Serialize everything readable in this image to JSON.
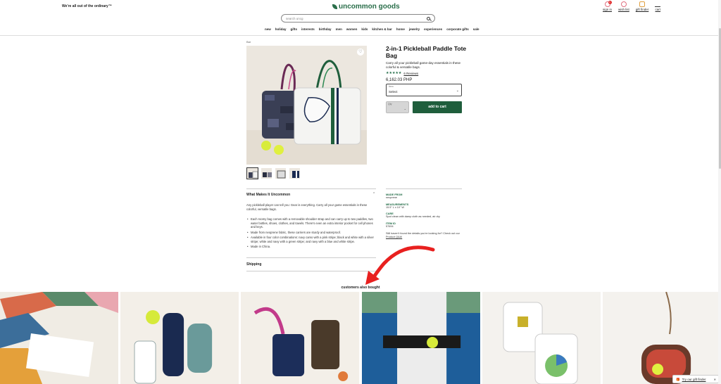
{
  "header": {
    "tagline": "We're all out of the ordinary™",
    "logo": "uncommon goods",
    "search_placeholder": "search uncg",
    "icons": [
      {
        "label": "sign in",
        "icon": "user-icon",
        "badge": "1"
      },
      {
        "label": "wish list",
        "icon": "heart-icon"
      },
      {
        "label": "gift finder",
        "icon": "gift-icon"
      },
      {
        "label": "cart",
        "icon": "cart-icon"
      }
    ],
    "nav": [
      "new",
      "holiday",
      "gifts",
      "interests",
      "birthday",
      "men",
      "women",
      "kids",
      "kitchen & bar",
      "home",
      "jewelry",
      "experiences",
      "corporate gifts",
      "sale"
    ]
  },
  "product": {
    "breadcrumb": "Bar",
    "title": "2-in-1 Pickleball Paddle Tote Bag",
    "description": "Carry all your pickleball game-day essentials in these colorful & versatile bags.",
    "stars": "★★★★★",
    "reviews": "6 Reviews",
    "price": "6,162.03 PHP",
    "select_label": "Item",
    "select_value": "Select",
    "qty_label": "Qty",
    "add_to_cart": "add to cart",
    "rating_color": "#1f6b45",
    "button_color": "#1f5e3c"
  },
  "details": {
    "section_title": "What Makes It Uncommon",
    "intro": "Any pickleball player can tell you: Gear is everything. Carry all your game essentials in these colorful, versatile bags.",
    "bullets": [
      "Each roomy bag comes with a removable shoulder strap and can carry up to two paddles, two water bottles, shoes, clothes, and towels. There's even an extra interior pocket for cell phones and keys.",
      "Made from neoprene fabric, these carriers are sturdy and waterproof.",
      "Available in four color combinations: navy camo with a pink stripe; black and white with a silver stripe; white and navy with a green stripe; and navy with a blue and white stripe.",
      "Made in China."
    ],
    "shipping": "Shipping"
  },
  "specs": {
    "made_from_label": "MADE FROM",
    "made_from": "neoprene",
    "measurements_label": "MEASUREMENTS",
    "measurements": "15.5\" L x 10\" W",
    "care_label": "CARE",
    "care": "Spot clean with damp cloth as needed, air dry",
    "item_id_label": "ITEM ID",
    "item_id": "57694",
    "help_text": "Still haven't found the details you're looking for? Check out our",
    "help_link": "Product Q&A!"
  },
  "also_bought": {
    "title": "customers also bought"
  },
  "gift_finder": {
    "label": "Try our gift finder",
    "close": "✕"
  }
}
